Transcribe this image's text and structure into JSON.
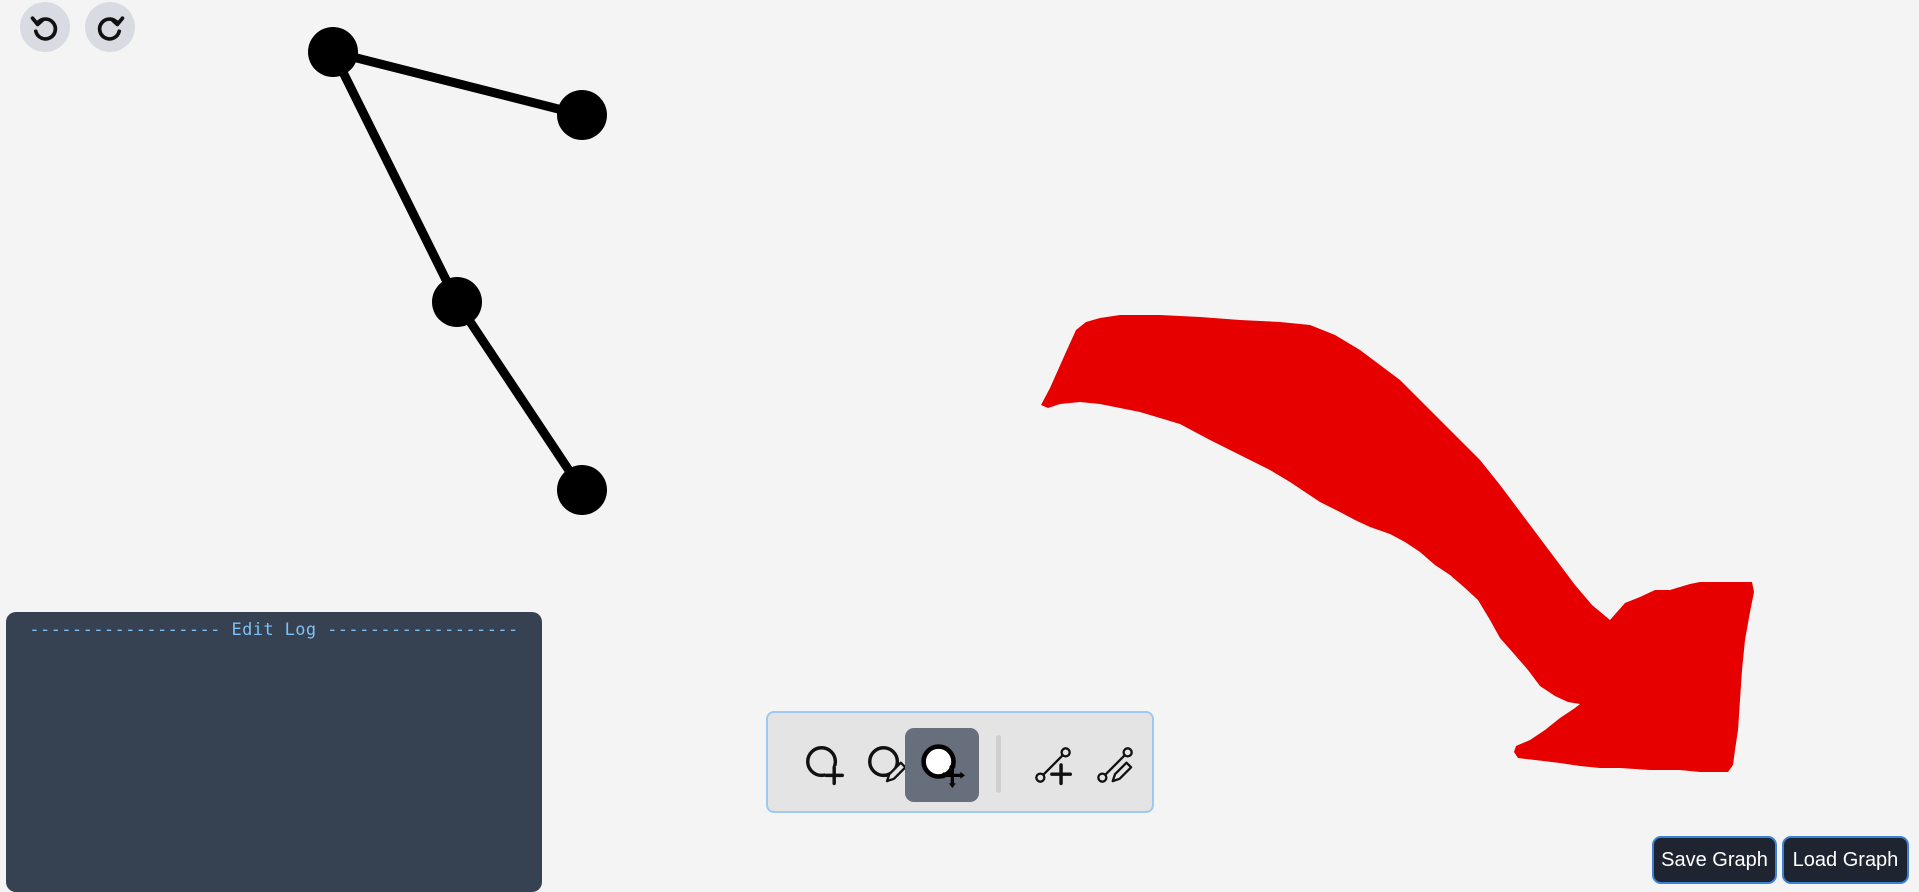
{
  "history": {
    "undo_icon": "undo-icon",
    "redo_icon": "redo-icon"
  },
  "edit_log": {
    "title": "------------------ Edit Log ------------------"
  },
  "toolbar": {
    "tools": [
      {
        "icon": "add-node-icon",
        "active": false
      },
      {
        "icon": "edit-node-icon",
        "active": false
      },
      {
        "icon": "move-node-icon",
        "active": true
      },
      {
        "icon": "add-edge-icon",
        "active": false
      },
      {
        "icon": "edit-edge-icon",
        "active": false
      }
    ]
  },
  "actions": {
    "save_label": "Save Graph",
    "load_label": "Load Graph"
  },
  "graph": {
    "nodes": 4,
    "edges": 3
  },
  "annotation": {
    "type": "arrow",
    "color": "#e60000"
  },
  "colors": {
    "background": "#f4f4f4",
    "node": "#000000",
    "log_bg": "#364152",
    "log_text": "#7fc0f5",
    "toolbar_border": "#9fc9f2",
    "active_tool": "#676e7c",
    "button_bg": "#1e2430",
    "button_border": "#3b82d6"
  }
}
